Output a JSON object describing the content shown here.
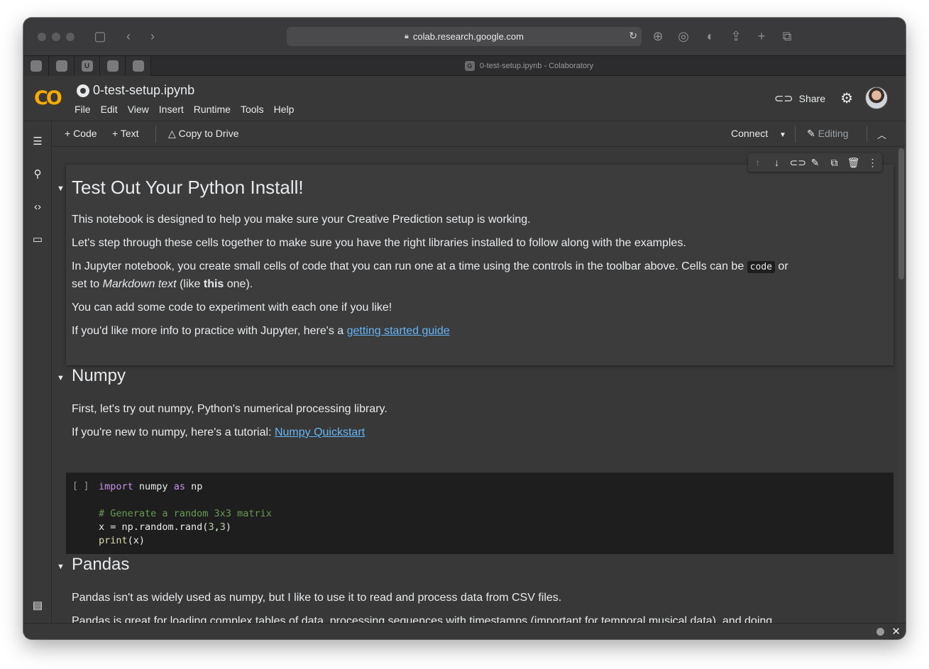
{
  "browser": {
    "url": "colab.research.google.com",
    "tab_title": "0-test-setup.ipynb - Colaboratory",
    "active_tab_favicon": "G",
    "pinned_tabs": [
      "",
      "",
      "U",
      "",
      ""
    ]
  },
  "header": {
    "logo": "CO",
    "notebook_title": "0-test-setup.ipynb",
    "menu": [
      "File",
      "Edit",
      "View",
      "Insert",
      "Runtime",
      "Tools",
      "Help"
    ],
    "share_label": "Share"
  },
  "toolbar": {
    "add_code": "+ Code",
    "add_text": "+ Text",
    "copy_to_drive": "Copy to Drive",
    "connect": "Connect",
    "editing": "Editing"
  },
  "cells": {
    "intro": {
      "heading": "Test Out Your Python Install!",
      "p1": "This notebook is designed to help you make sure your Creative Prediction setup is working.",
      "p2": "Let's step through these cells together to make sure you have the right libraries installed to follow along with the examples.",
      "p3_a": "In Jupyter notebook, you create small cells of code that you can run one at a time using the controls in the toolbar above. Cells can be ",
      "p3_code": "code",
      "p3_b": " or",
      "p3_c": "set to ",
      "p3_em": "Markdown text",
      "p3_d": " (like ",
      "p3_strong": "this",
      "p3_e": " one).",
      "p4": "You can add some code to experiment with each one if you like!",
      "p5_a": "If you'd like more info to practice with Jupyter, here's a ",
      "p5_link": "getting started guide"
    },
    "numpy": {
      "heading": "Numpy",
      "p1": "First, let's try out numpy, Python's numerical processing library.",
      "p2_a": "If you're new to numpy, here's a tutorial: ",
      "p2_link": "Numpy Quickstart"
    },
    "code1": {
      "run_indicator": "[ ]",
      "line1_kw1": "import",
      "line1_mid": " numpy ",
      "line1_kw2": "as",
      "line1_end": " np",
      "line3": "# Generate a random 3x3 matrix",
      "line4_a": "x = np.random.rand(",
      "line4_n1": "3",
      "line4_comma": ",",
      "line4_n2": "3",
      "line4_b": ")",
      "line5_fn": "print",
      "line5_b": "(x)"
    },
    "pandas": {
      "heading": "Pandas",
      "p1": "Pandas isn't as widely used as numpy, but I like to use it to read and process data from CSV files.",
      "p2": "Pandas is great for loading complex tables of data, processing sequences with timestamps (important for temporal musical data), and doing"
    }
  },
  "colors": {
    "accent_logo": "#f9ab00",
    "link": "#64b5f6",
    "background": "#383838"
  }
}
